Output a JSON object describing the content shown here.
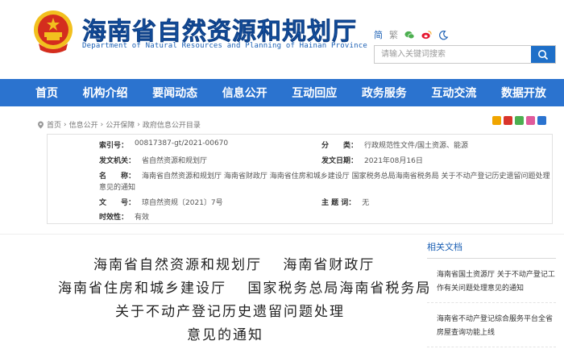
{
  "header": {
    "title": "海南省自然资源和规划厅",
    "subtitle": "Department of Natural Resources and Planning of Hainan Province",
    "tools": {
      "simplified": "简",
      "traditional": "繁"
    },
    "search_placeholder": "请输入关键词搜索"
  },
  "nav": {
    "items": [
      "首页",
      "机构介绍",
      "要闻动态",
      "信息公开",
      "互动回应",
      "政务服务",
      "互动交流",
      "数据开放"
    ]
  },
  "breadcrumb": [
    "首页",
    "信息公开",
    "公开保障",
    "政府信息公开目录"
  ],
  "info": {
    "index_label": "索引号：",
    "index_value": "00817387-gt/2021-00670",
    "category_label": "分　　类：",
    "category_value": "行政规范性文件/国土资源、能源",
    "issuer_label": "发文机关：",
    "issuer_value": "省自然资源和规划厅",
    "date_label": "发文日期：",
    "date_value": "2021年08月16日",
    "name_label": "名　　称：",
    "name_value_1": "海南省自然资源和规划厅 海南省财政厅 海南省住房和城乡建设厅 国家税务总局海南省税务局 关于不动产登记历史遗留问题处理",
    "name_value_2": "意见的通知",
    "docno_label": "文　　号：",
    "docno_value": "琼自然资规〔2021〕7号",
    "subject_label": "主 题 词：",
    "subject_value": "无",
    "validity_label": "时效性：",
    "validity_value": "有效"
  },
  "document": {
    "line1": "海南省自然资源和规划厅　 海南省财政厅",
    "line2": "海南省住房和城乡建设厅　 国家税务总局海南省税务局",
    "line3": "关于不动产登记历史遗留问题处理",
    "line4": "意见的通知"
  },
  "related": {
    "title": "相关文档",
    "items": [
      "海南省国土资源厅 关于不动产登记工作有关问题处理意见的通知",
      "海南省不动产登记综合服务平台全省房屋查询功能上线"
    ]
  },
  "colors": {
    "brand": "#1a5fb4",
    "nav": "#2b73cf",
    "emblem_red": "#d42d1e",
    "emblem_gold": "#f2c01e"
  }
}
